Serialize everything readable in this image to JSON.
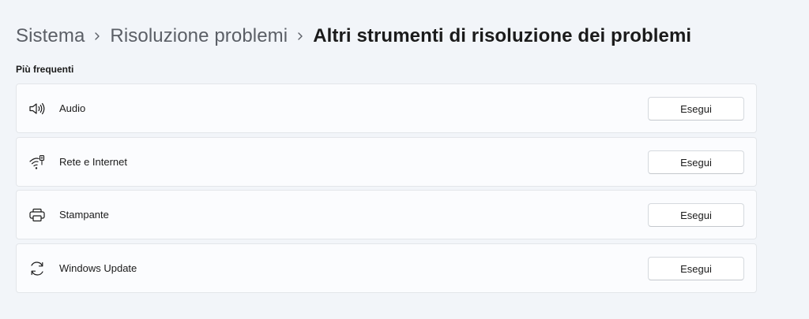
{
  "breadcrumb": {
    "items": [
      "Sistema",
      "Risoluzione problemi"
    ],
    "current": "Altri strumenti di risoluzione dei problemi"
  },
  "section": {
    "title": "Più frequenti"
  },
  "troubleshooters": [
    {
      "label": "Audio",
      "icon": "speaker-icon",
      "button": "Esegui"
    },
    {
      "label": "Rete e Internet",
      "icon": "wifi-network-icon",
      "button": "Esegui"
    },
    {
      "label": "Stampante",
      "icon": "printer-icon",
      "button": "Esegui"
    },
    {
      "label": "Windows Update",
      "icon": "sync-icon",
      "button": "Esegui"
    }
  ],
  "colors": {
    "background": "#f2f5f9",
    "card": "#fbfcfe",
    "text": "#1b1b1b",
    "muted_text": "#5b5f66"
  }
}
